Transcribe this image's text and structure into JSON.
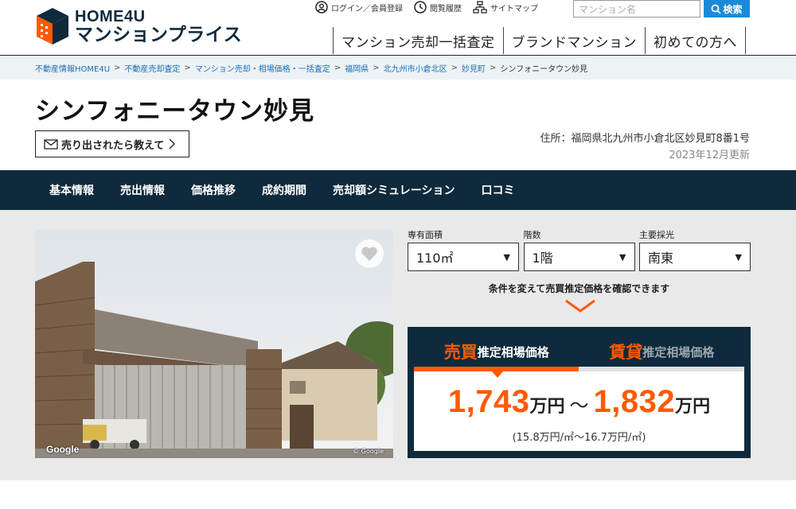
{
  "header": {
    "logo_top": "HOME4U",
    "logo_bottom": "マンションプライス",
    "util": {
      "login": "ログイン／会員登録",
      "history": "閲覧履歴",
      "sitemap": "サイトマップ"
    },
    "search": {
      "placeholder": "マンション名",
      "button": "検索"
    },
    "nav": [
      "マンション売却一括査定",
      "ブランドマンション",
      "初めての方へ"
    ]
  },
  "breadcrumb": [
    "不動産情報HOME4U",
    "不動産売却査定",
    "マンション売却・相場価格・一括査定",
    "福岡県",
    "北九州市小倉北区",
    "妙見町",
    "シンフォニータウン妙見"
  ],
  "property": {
    "title": "シンフォニータウン妙見",
    "notify_label": "売り出されたら教えて",
    "address": "住所：福岡県北九州市小倉北区妙見町8番1号",
    "updated": "2023年12月更新"
  },
  "tabs": [
    "基本情報",
    "売出情報",
    "価格推移",
    "成約期間",
    "売却額シミュレーション",
    "口コミ"
  ],
  "photo": {
    "google_tag": "Google",
    "copyright": "© Google"
  },
  "filters": [
    {
      "label": "専有面積",
      "value": "110㎡"
    },
    {
      "label": "階数",
      "value": "1階"
    },
    {
      "label": "主要採光",
      "value": "南東"
    }
  ],
  "hint": "条件を変えて売買推定価格を確認できます",
  "price": {
    "tab_sale_big": "売買",
    "tab_sale_small": "推定相場価格",
    "tab_rent_big": "賃貸",
    "tab_rent_small": "推定相場価格",
    "low": "1,743",
    "high": "1,832",
    "unit": "万円",
    "tilde": "～",
    "per_sqm": "(15.8万円/㎡～16.7万円/㎡)"
  },
  "colors": {
    "navy": "#0f2a3d",
    "accent": "#ff5a00",
    "link": "#1a6fb5",
    "search_btn": "#1a8ad8"
  }
}
